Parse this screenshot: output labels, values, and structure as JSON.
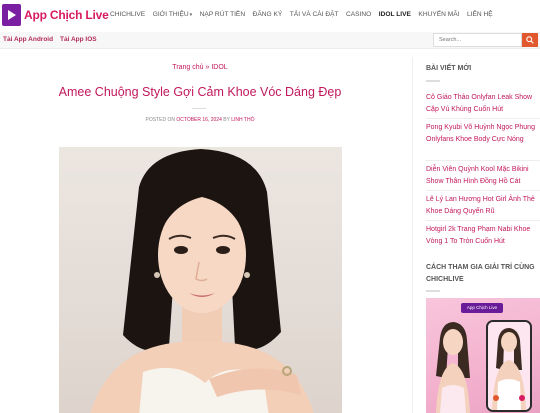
{
  "header": {
    "logo_text": "App Chịch Live",
    "nav": [
      {
        "label": "CHICHLIVE"
      },
      {
        "label": "GIỚI THIỆU",
        "has_caret": true
      },
      {
        "label": "NẠP RÚT TIỀN"
      },
      {
        "label": "ĐĂNG KÝ"
      },
      {
        "label": "TẢI VÀ CÀI ĐẶT"
      },
      {
        "label": "CASINO"
      },
      {
        "label": "IDOL LIVE",
        "active": true
      },
      {
        "label": "KHUYẾN MÃI"
      },
      {
        "label": "LIÊN HỆ"
      }
    ]
  },
  "subbar": {
    "android_link": "Tải App Android",
    "ios_link": "Tải App IOS",
    "search_placeholder": "Search..."
  },
  "article": {
    "breadcrumb_home": "Trang chủ",
    "breadcrumb_sep": " » ",
    "breadcrumb_current": "IDOL",
    "title": "Amee Chuộng Style Gợi Cảm Khoe Vóc Dáng Đẹp",
    "meta_posted": "POSTED ON ",
    "meta_date": "OCTOBER 16, 2024",
    "meta_by": " BY ",
    "meta_author": "LINH THỎ"
  },
  "sidebar": {
    "recent_title": "BÀI VIẾT MỚI",
    "posts": [
      "Cô Giáo Thảo Onlyfan Leak Show Cặp Vú Khủng Cuốn Hút",
      "Pong Kyubi Võ Huỳnh Ngọc Phụng Onlyfans Khoe Body Cực Nóng",
      "Diễn Viên Quỳnh Kool Mặc Bikini Show Thân Hình Đồng Hồ Cát",
      "Lê Lý Lan Hương Hot Girl Ảnh Thẻ Khoe Dáng Quyến Rũ",
      "Hotgirl 2k Trang Phạm Nabi Khoe Vòng 1 To Tròn Cuốn Hút"
    ],
    "guide_title": "CÁCH THAM GIA GIẢI TRÍ CÙNG CHICHLIVE",
    "promo_logo": "App Chịch Live"
  },
  "colors": {
    "accent": "#c2185b",
    "logo": "#d81b60",
    "search_button": "#e1582e"
  }
}
